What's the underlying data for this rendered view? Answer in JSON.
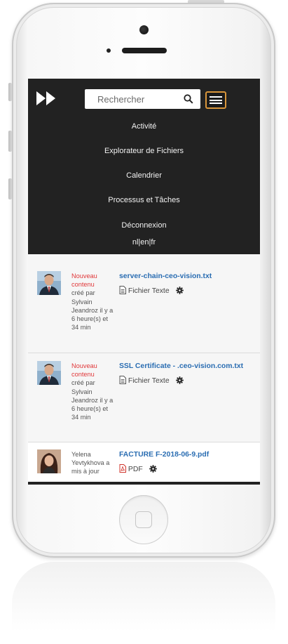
{
  "search": {
    "placeholder": "Rechercher"
  },
  "nav": {
    "items": [
      {
        "label": "Activité"
      },
      {
        "label": "Explorateur de Fichiers"
      },
      {
        "label": "Calendrier"
      },
      {
        "label": "Processus et Tâches"
      },
      {
        "label": "Déconnexion"
      }
    ],
    "languages": "nl|en|fr"
  },
  "feed": [
    {
      "status": "Nouveau contenu",
      "detail": "créé par Sylvain Jeandroz il y a 6 heure(s) et 34 min",
      "title": "server-chain-ceo-vision.txt",
      "file_type": "Fichier Texte",
      "file_icon": "text-file-icon"
    },
    {
      "status": "Nouveau contenu",
      "detail": "créé par Sylvain Jeandroz il y a 6 heure(s) et 34 min",
      "title": "SSL Certificate - .ceo-vision.com.txt",
      "file_type": "Fichier Texte",
      "file_icon": "text-file-icon"
    },
    {
      "status": "",
      "detail": "Yelena Yevtykhova a mis à jour",
      "title": "FACTURE F-2018-06-9.pdf",
      "file_type": "PDF",
      "file_icon": "pdf-file-icon"
    }
  ],
  "colors": {
    "header_bg": "#222222",
    "menu_border": "#d9963b",
    "new_content": "#e0383a",
    "link": "#2a6db2"
  }
}
